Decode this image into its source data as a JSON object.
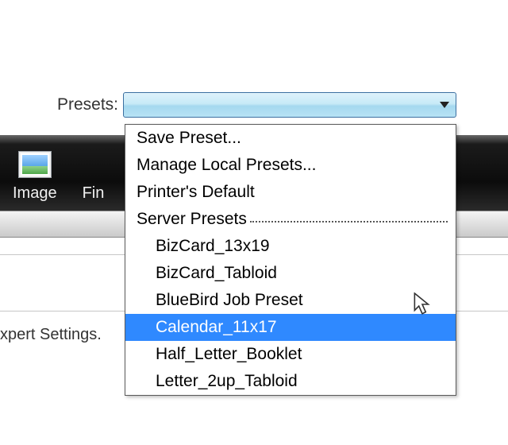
{
  "presets": {
    "label": "Presets:",
    "selected": ""
  },
  "toolbar": {
    "items": [
      {
        "label": "Image"
      },
      {
        "label": "Fin"
      }
    ]
  },
  "expert_settings_label": "xpert Settings.",
  "dropdown": {
    "save_preset": "Save Preset...",
    "manage_local": "Manage Local Presets...",
    "printer_default": "Printer's Default",
    "section_server": "Server Presets",
    "server_items": [
      "BizCard_13x19",
      "BizCard_Tabloid",
      "BlueBird Job Preset",
      "Calendar_11x17",
      "Half_Letter_Booklet",
      "Letter_2up_Tabloid"
    ],
    "highlighted_index": 3
  }
}
